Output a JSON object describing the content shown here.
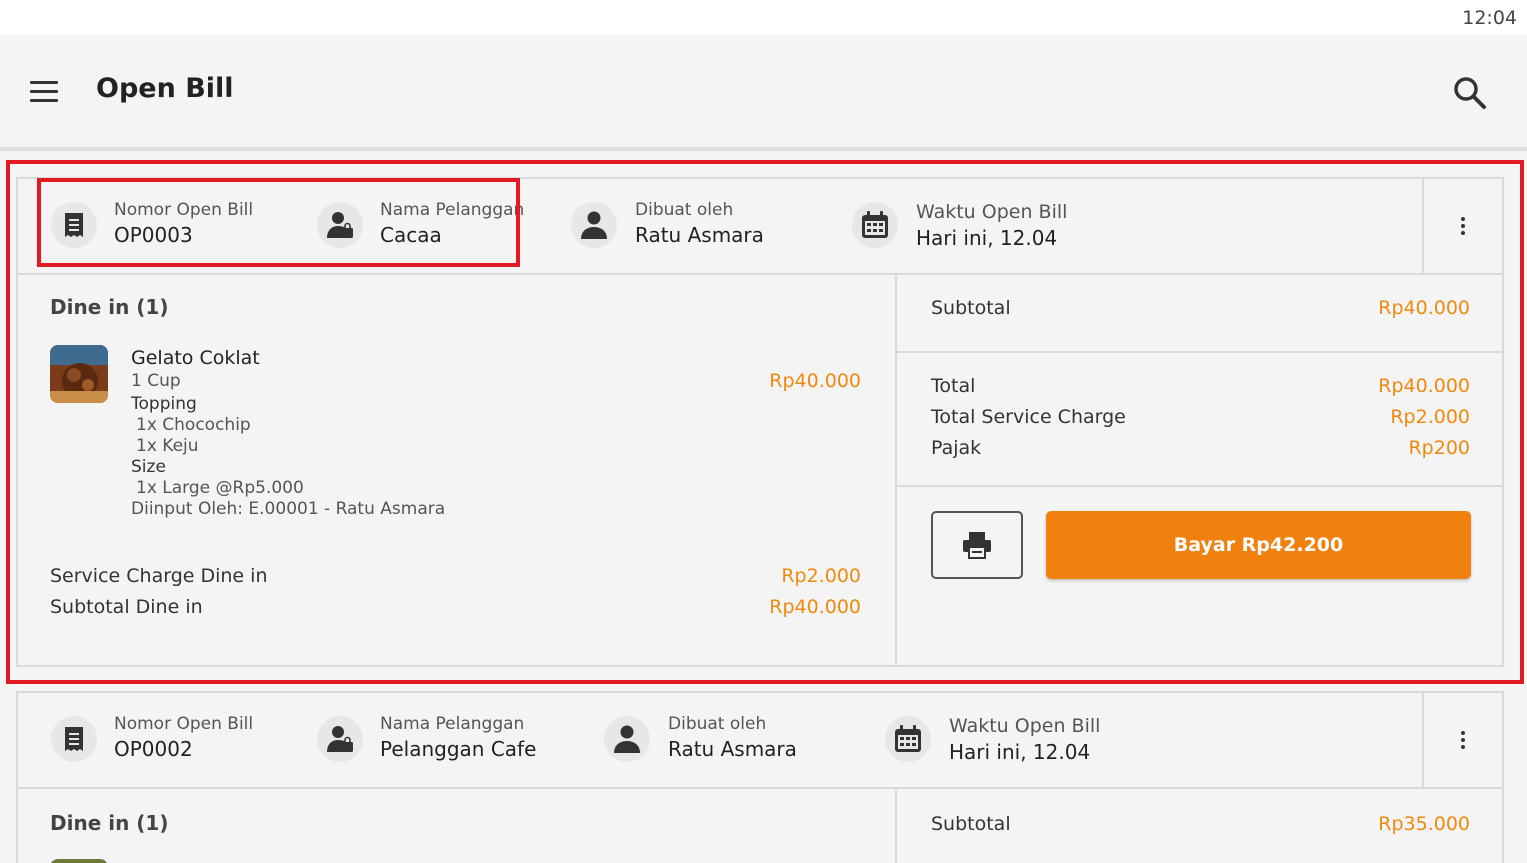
{
  "status_bar": {
    "time": "12:04"
  },
  "app_bar": {
    "title": "Open Bill"
  },
  "bills": [
    {
      "number_label": "Nomor Open Bill",
      "number": "OP0003",
      "customer_label": "Nama Pelanggan",
      "customer": "Cacaa",
      "created_by_label": "Dibuat oleh",
      "created_by": "Ratu Asmara",
      "time_label": "Waktu Open Bill",
      "time": "Hari ini, 12.04",
      "section_title": "Dine in (1)",
      "item": {
        "name": "Gelato Coklat",
        "quantity": "1 Cup",
        "price": "Rp40.000",
        "topping_label": "Topping",
        "toppings": [
          "1x Chocochip",
          "1x Keju"
        ],
        "size_label": "Size",
        "size": "1x Large @Rp5.000",
        "input_by": "Diinput Oleh:  E.00001 - Ratu Asmara"
      },
      "service_charge_label": "Service Charge Dine in",
      "service_charge": "Rp2.000",
      "subtotal_dine_label": "Subtotal Dine in",
      "subtotal_dine": "Rp40.000",
      "subtotal_label": "Subtotal",
      "subtotal": "Rp40.000",
      "total_label": "Total",
      "total": "Rp40.000",
      "total_service_label": "Total Service Charge",
      "total_service": "Rp2.000",
      "tax_label": "Pajak",
      "tax": "Rp200",
      "pay_label": "Bayar Rp42.200"
    },
    {
      "number_label": "Nomor Open Bill",
      "number": "OP0002",
      "customer_label": "Nama Pelanggan",
      "customer": "Pelanggan Cafe",
      "created_by_label": "Dibuat oleh",
      "created_by": "Ratu Asmara",
      "time_label": "Waktu Open Bill",
      "time": "Hari ini, 12.04",
      "section_title": "Dine in (1)",
      "subtotal_label": "Subtotal",
      "subtotal": "Rp35.000"
    }
  ],
  "colors": {
    "accent": "#f0810f",
    "highlight": "#e01b24"
  },
  "icons": [
    "menu-icon",
    "search-icon",
    "receipt-icon",
    "customer-icon",
    "person-icon",
    "calendar-icon",
    "more-vert-icon",
    "printer-icon"
  ]
}
